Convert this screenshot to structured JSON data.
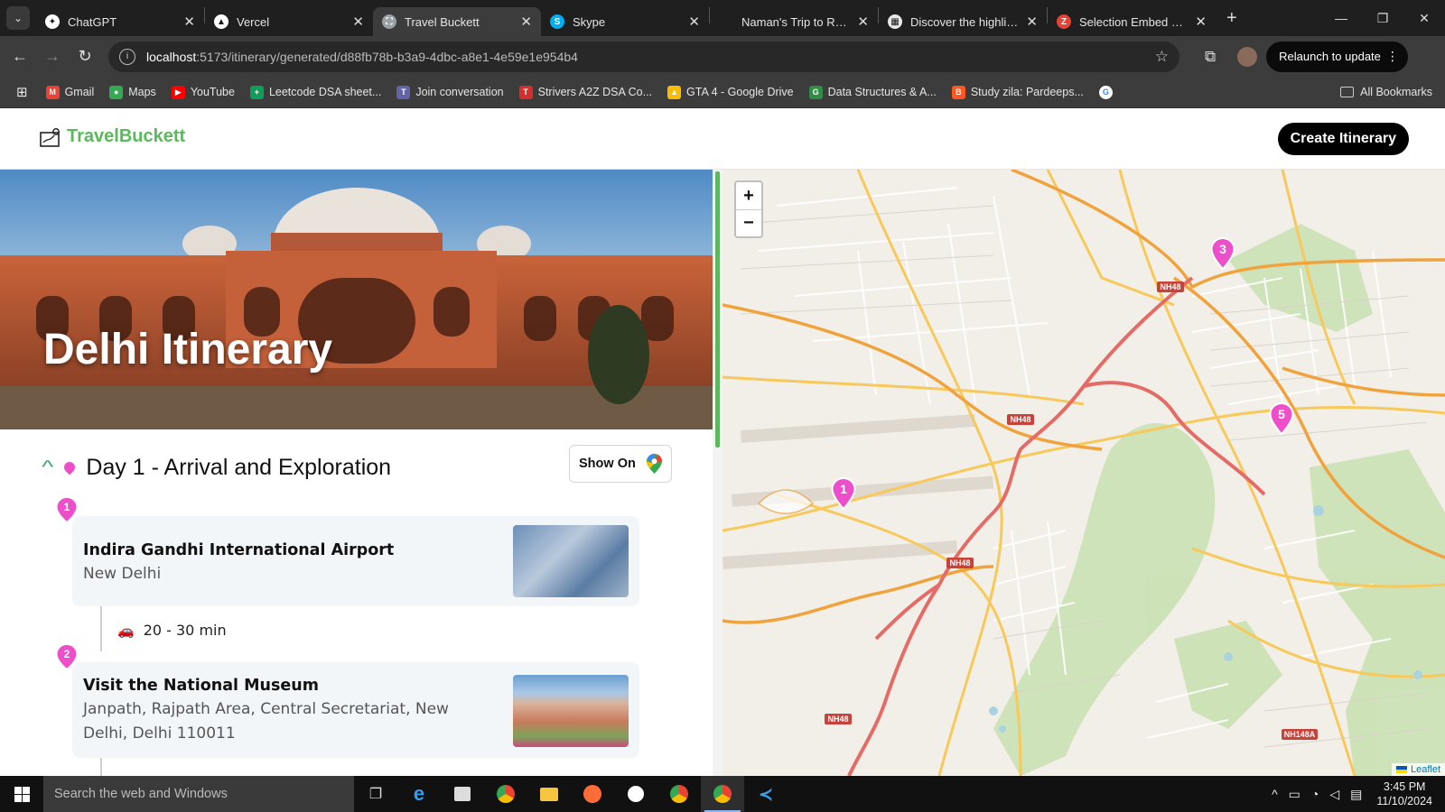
{
  "browser": {
    "tabs": [
      {
        "title": "ChatGPT",
        "icon": "chatgpt-icon",
        "color": "#ffffff",
        "glyph": "✦",
        "active": false
      },
      {
        "title": "Vercel",
        "icon": "vercel-icon",
        "color": "#ffffff",
        "glyph": "▲",
        "active": false
      },
      {
        "title": "Travel Buckett",
        "icon": "travel-buckett-icon",
        "color": "#9aa0a6",
        "glyph": "⛶",
        "active": true
      },
      {
        "title": "Skype",
        "icon": "skype-icon",
        "color": "#00aff0",
        "glyph": "S",
        "active": false
      },
      {
        "title": "Naman's Trip to Rome,",
        "icon": "page-icon",
        "color": "#1f1f1f",
        "glyph": "",
        "active": false
      },
      {
        "title": "Discover the highlights",
        "icon": "document-icon",
        "color": "#e8e8e8",
        "glyph": "▦",
        "active": false
      },
      {
        "title": "Selection Embed Code",
        "icon": "zoho-icon",
        "color": "#e94235",
        "glyph": "Z",
        "active": false
      }
    ],
    "url_host": "localhost",
    "url_rest": ":5173/itinerary/generated/d88fb78b-b3a9-4dbc-a8e1-4e59e1e954b4",
    "relaunch_label": "Relaunch to update",
    "bookmarks": [
      {
        "label": "Gmail",
        "icon": "gmail-icon",
        "color": "#ea4335",
        "glyph": "M"
      },
      {
        "label": "Maps",
        "icon": "maps-icon",
        "color": "#34a853",
        "glyph": "●"
      },
      {
        "label": "YouTube",
        "icon": "youtube-icon",
        "color": "#ff0000",
        "glyph": "▶"
      },
      {
        "label": "Leetcode DSA sheet...",
        "icon": "sheets-icon",
        "color": "#0f9d58",
        "glyph": "+"
      },
      {
        "label": "Join conversation",
        "icon": "teams-icon",
        "color": "#6264a7",
        "glyph": "T"
      },
      {
        "label": "Strivers A2Z DSA Co...",
        "icon": "tuf-icon",
        "color": "#d32f2f",
        "glyph": "T"
      },
      {
        "label": "GTA 4 - Google Drive",
        "icon": "drive-icon",
        "color": "#fbbc04",
        "glyph": "▲"
      },
      {
        "label": "Data Structures & A...",
        "icon": "gfg-icon",
        "color": "#2f8d46",
        "glyph": "G"
      },
      {
        "label": "Study zila: Pardeeps...",
        "icon": "blogger-icon",
        "color": "#ff5722",
        "glyph": "B"
      },
      {
        "label": "",
        "icon": "google-icon",
        "color": "#ffffff",
        "glyph": "G"
      }
    ],
    "all_bookmarks": "All Bookmarks"
  },
  "header": {
    "brand": "TravelBuckett",
    "create_label": "Create Itinerary"
  },
  "hero": {
    "title": "Delhi Itinerary"
  },
  "day": {
    "title": "Day 1 - Arrival and Exploration",
    "show_on_label": "Show On"
  },
  "stops": [
    {
      "num": "1",
      "name": "Indira Gandhi International Airport",
      "address": "New Delhi"
    },
    {
      "num": "2",
      "name": "Visit the National Museum",
      "address": "Janpath, Rajpath Area, Central Secretariat, New Delhi, Delhi 110011"
    }
  ],
  "travel": {
    "duration": "20 - 30 min"
  },
  "map": {
    "zoom_in": "+",
    "zoom_out": "−",
    "markers": [
      "1",
      "3",
      "5"
    ],
    "road_labels": [
      "NH48",
      "NH48",
      "NH48",
      "NH48",
      "NH148A"
    ],
    "attribution": "Leaflet"
  },
  "taskbar": {
    "search_placeholder": "Search the web and Windows",
    "time": "3:45 PM",
    "date": "11/10/2024"
  },
  "colors": {
    "brand_green": "#5cb85c",
    "marker_pink": "#ec4fc9",
    "card_bg": "#f3f6f9"
  }
}
